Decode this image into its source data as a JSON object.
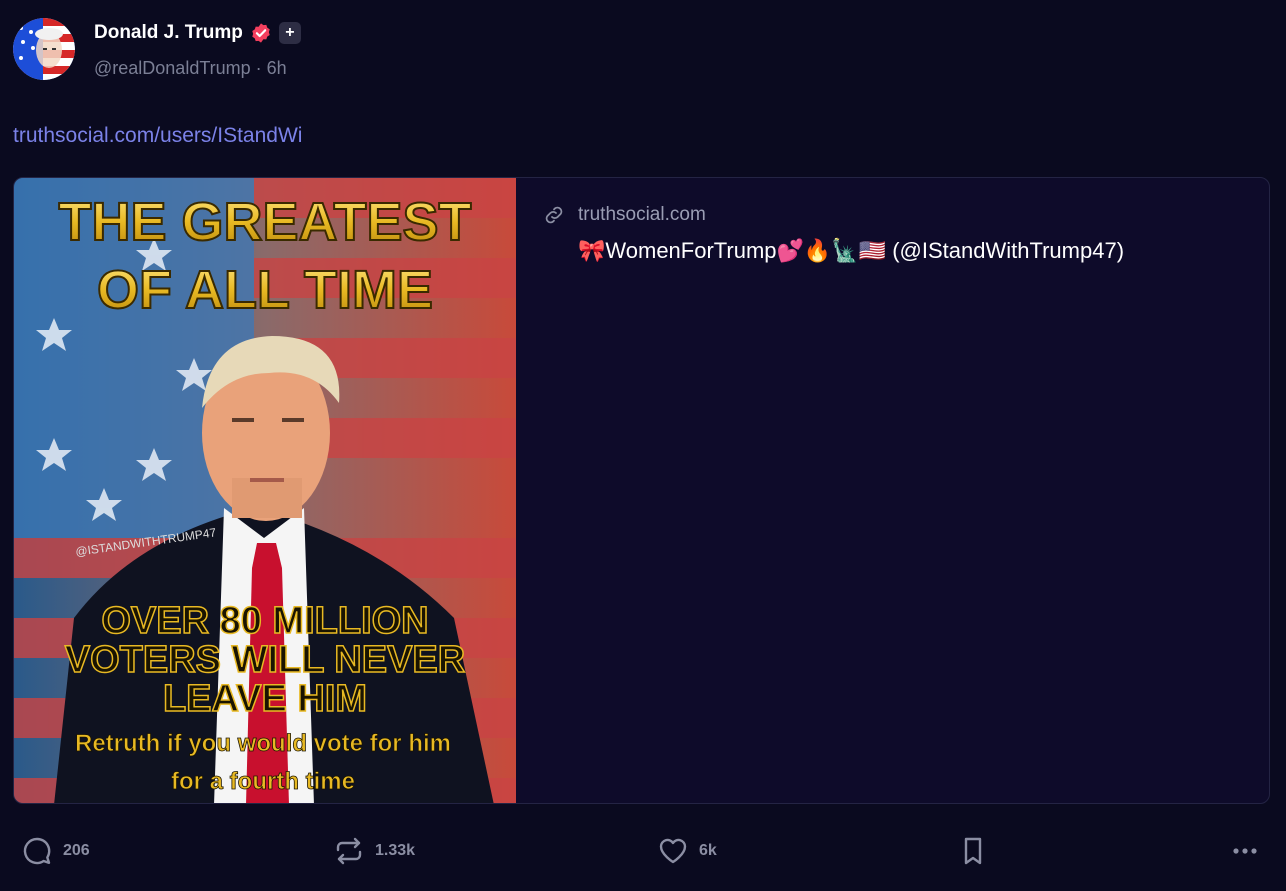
{
  "author": {
    "display_name": "Donald J. Trump",
    "handle": "@realDonaldTrump",
    "separator": "·",
    "time_ago": "6h",
    "plus_badge": "+"
  },
  "post": {
    "link_text": "truthsocial.com/users/IStandWi"
  },
  "card": {
    "domain": "truthsocial.com",
    "title": "🎀WomenForTrump💕🔥🗽🇺🇸 (@IStandWithTrump47)",
    "image": {
      "headline_1": "THE GREATEST",
      "headline_2": "OF ALL TIME",
      "watermark": "@ISTANDWITHTRUMP47",
      "line_1": "OVER 80 MILLION",
      "line_2": "VOTERS WILL NEVER",
      "line_3": "LEAVE HIM",
      "line_4": "Retruth if you would vote for him",
      "line_5": "for a fourth time"
    }
  },
  "actions": {
    "replies": "206",
    "retruths": "1.33k",
    "likes": "6k"
  },
  "colors": {
    "background": "#0a0a1f",
    "card_background": "#0e0b2a",
    "link": "#7b82e8",
    "verified": "#f43f5e",
    "muted": "#7b7f95",
    "gold": "#e8b923"
  }
}
